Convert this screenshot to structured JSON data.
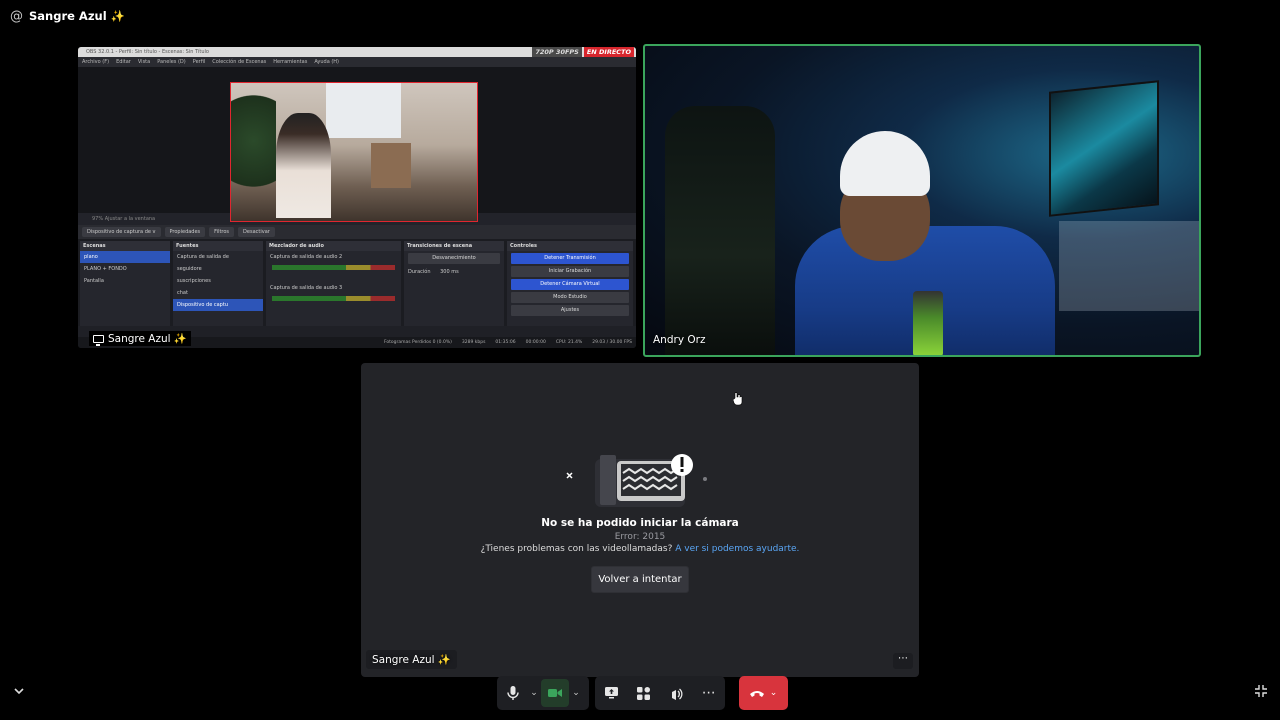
{
  "header": {
    "channel_icon": "@",
    "title": "Sangre Azul ✨"
  },
  "share_tile": {
    "name": "Sangre Azul ✨",
    "obs": {
      "window_title": "OBS 32.0.1 - Perfil: Sin título - Escenas: Sin Título",
      "badge_quality": "720P 30FPS",
      "badge_live": "EN DIRECTO",
      "menu": [
        "Archivo (F)",
        "Editar",
        "Vista",
        "Paneles (D)",
        "Perfil",
        "Colección de Escenas",
        "Herramientas",
        "Ayuda (H)"
      ],
      "strip": "97%   Ajustar a la ventana",
      "tabs": [
        "Dispositivo de captura de v",
        "Propiedades",
        "Filtros",
        "Desactivar"
      ],
      "scenes": {
        "title": "Escenas",
        "items": [
          "plano",
          "PLANO + FONDO",
          "Pantalla"
        ]
      },
      "sources": {
        "title": "Fuentes",
        "items": [
          "Captura de salida de",
          "seguidore",
          "suscripciones",
          "chat",
          "Dispositivo de captu"
        ]
      },
      "mixer": {
        "title": "Mezclador de audio",
        "ch1": "Captura de salida de audio 2",
        "ch2": "Captura de salida de audio 3"
      },
      "transitions": {
        "title": "Transiciones de escena",
        "type": "Desvanecimiento",
        "duration_label": "Duración",
        "duration": "300 ms"
      },
      "controls": {
        "title": "Controles",
        "buttons": [
          "Detener Transmisión",
          "Iniciar Grabación",
          "Detener Cámara Virtual",
          "Modo Estudio",
          "Ajustes"
        ]
      },
      "status": [
        "Fotogramas Perdidos 0 (0.0%)",
        "3289 kbps",
        "01:35:06",
        "00:00:00",
        "CPU: 21.4%",
        "29.03 / 30.00 FPS"
      ]
    }
  },
  "andry_tile": {
    "name": "Andry Orz",
    "speaking_color": "#3ba55c"
  },
  "camera_error_tile": {
    "name": "Sangre Azul ✨",
    "title": "No se ha podido iniciar la cámara",
    "code": "Error: 2015",
    "help_text": "¿Tienes problemas con las videollamadas?",
    "help_link": "A ver si podemos ayudarte.",
    "retry_label": "Volver a intentar",
    "more_icon": "⋯"
  },
  "controls": {
    "mic_icon": "microphone-icon",
    "camera_icon": "video-camera-icon",
    "screen_icon": "screen-share-icon",
    "activities_icon": "activities-icon",
    "soundboard_icon": "soundboard-icon",
    "more_icon": "⋯",
    "leave_icon": "hang-up-icon",
    "leave_color": "#d8343d"
  },
  "corner": {
    "left_icon": "chevron-down-icon",
    "right_icon": "collapse-icon"
  }
}
